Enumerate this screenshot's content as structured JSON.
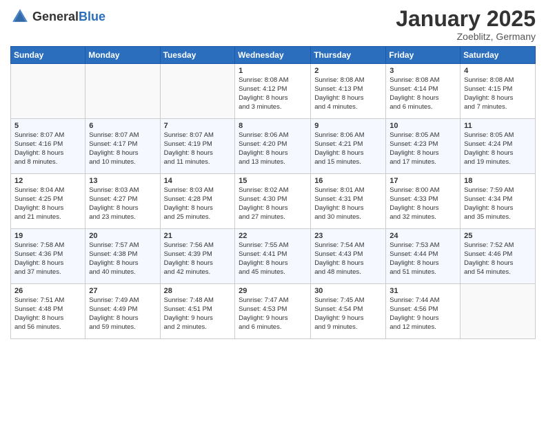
{
  "header": {
    "logo_general": "General",
    "logo_blue": "Blue",
    "month_title": "January 2025",
    "subtitle": "Zoeblitz, Germany"
  },
  "weekdays": [
    "Sunday",
    "Monday",
    "Tuesday",
    "Wednesday",
    "Thursday",
    "Friday",
    "Saturday"
  ],
  "weeks": [
    [
      {
        "day": "",
        "info": ""
      },
      {
        "day": "",
        "info": ""
      },
      {
        "day": "",
        "info": ""
      },
      {
        "day": "1",
        "info": "Sunrise: 8:08 AM\nSunset: 4:12 PM\nDaylight: 8 hours\nand 3 minutes."
      },
      {
        "day": "2",
        "info": "Sunrise: 8:08 AM\nSunset: 4:13 PM\nDaylight: 8 hours\nand 4 minutes."
      },
      {
        "day": "3",
        "info": "Sunrise: 8:08 AM\nSunset: 4:14 PM\nDaylight: 8 hours\nand 6 minutes."
      },
      {
        "day": "4",
        "info": "Sunrise: 8:08 AM\nSunset: 4:15 PM\nDaylight: 8 hours\nand 7 minutes."
      }
    ],
    [
      {
        "day": "5",
        "info": "Sunrise: 8:07 AM\nSunset: 4:16 PM\nDaylight: 8 hours\nand 8 minutes."
      },
      {
        "day": "6",
        "info": "Sunrise: 8:07 AM\nSunset: 4:17 PM\nDaylight: 8 hours\nand 10 minutes."
      },
      {
        "day": "7",
        "info": "Sunrise: 8:07 AM\nSunset: 4:19 PM\nDaylight: 8 hours\nand 11 minutes."
      },
      {
        "day": "8",
        "info": "Sunrise: 8:06 AM\nSunset: 4:20 PM\nDaylight: 8 hours\nand 13 minutes."
      },
      {
        "day": "9",
        "info": "Sunrise: 8:06 AM\nSunset: 4:21 PM\nDaylight: 8 hours\nand 15 minutes."
      },
      {
        "day": "10",
        "info": "Sunrise: 8:05 AM\nSunset: 4:23 PM\nDaylight: 8 hours\nand 17 minutes."
      },
      {
        "day": "11",
        "info": "Sunrise: 8:05 AM\nSunset: 4:24 PM\nDaylight: 8 hours\nand 19 minutes."
      }
    ],
    [
      {
        "day": "12",
        "info": "Sunrise: 8:04 AM\nSunset: 4:25 PM\nDaylight: 8 hours\nand 21 minutes."
      },
      {
        "day": "13",
        "info": "Sunrise: 8:03 AM\nSunset: 4:27 PM\nDaylight: 8 hours\nand 23 minutes."
      },
      {
        "day": "14",
        "info": "Sunrise: 8:03 AM\nSunset: 4:28 PM\nDaylight: 8 hours\nand 25 minutes."
      },
      {
        "day": "15",
        "info": "Sunrise: 8:02 AM\nSunset: 4:30 PM\nDaylight: 8 hours\nand 27 minutes."
      },
      {
        "day": "16",
        "info": "Sunrise: 8:01 AM\nSunset: 4:31 PM\nDaylight: 8 hours\nand 30 minutes."
      },
      {
        "day": "17",
        "info": "Sunrise: 8:00 AM\nSunset: 4:33 PM\nDaylight: 8 hours\nand 32 minutes."
      },
      {
        "day": "18",
        "info": "Sunrise: 7:59 AM\nSunset: 4:34 PM\nDaylight: 8 hours\nand 35 minutes."
      }
    ],
    [
      {
        "day": "19",
        "info": "Sunrise: 7:58 AM\nSunset: 4:36 PM\nDaylight: 8 hours\nand 37 minutes."
      },
      {
        "day": "20",
        "info": "Sunrise: 7:57 AM\nSunset: 4:38 PM\nDaylight: 8 hours\nand 40 minutes."
      },
      {
        "day": "21",
        "info": "Sunrise: 7:56 AM\nSunset: 4:39 PM\nDaylight: 8 hours\nand 42 minutes."
      },
      {
        "day": "22",
        "info": "Sunrise: 7:55 AM\nSunset: 4:41 PM\nDaylight: 8 hours\nand 45 minutes."
      },
      {
        "day": "23",
        "info": "Sunrise: 7:54 AM\nSunset: 4:43 PM\nDaylight: 8 hours\nand 48 minutes."
      },
      {
        "day": "24",
        "info": "Sunrise: 7:53 AM\nSunset: 4:44 PM\nDaylight: 8 hours\nand 51 minutes."
      },
      {
        "day": "25",
        "info": "Sunrise: 7:52 AM\nSunset: 4:46 PM\nDaylight: 8 hours\nand 54 minutes."
      }
    ],
    [
      {
        "day": "26",
        "info": "Sunrise: 7:51 AM\nSunset: 4:48 PM\nDaylight: 8 hours\nand 56 minutes."
      },
      {
        "day": "27",
        "info": "Sunrise: 7:49 AM\nSunset: 4:49 PM\nDaylight: 8 hours\nand 59 minutes."
      },
      {
        "day": "28",
        "info": "Sunrise: 7:48 AM\nSunset: 4:51 PM\nDaylight: 9 hours\nand 2 minutes."
      },
      {
        "day": "29",
        "info": "Sunrise: 7:47 AM\nSunset: 4:53 PM\nDaylight: 9 hours\nand 6 minutes."
      },
      {
        "day": "30",
        "info": "Sunrise: 7:45 AM\nSunset: 4:54 PM\nDaylight: 9 hours\nand 9 minutes."
      },
      {
        "day": "31",
        "info": "Sunrise: 7:44 AM\nSunset: 4:56 PM\nDaylight: 9 hours\nand 12 minutes."
      },
      {
        "day": "",
        "info": ""
      }
    ]
  ]
}
